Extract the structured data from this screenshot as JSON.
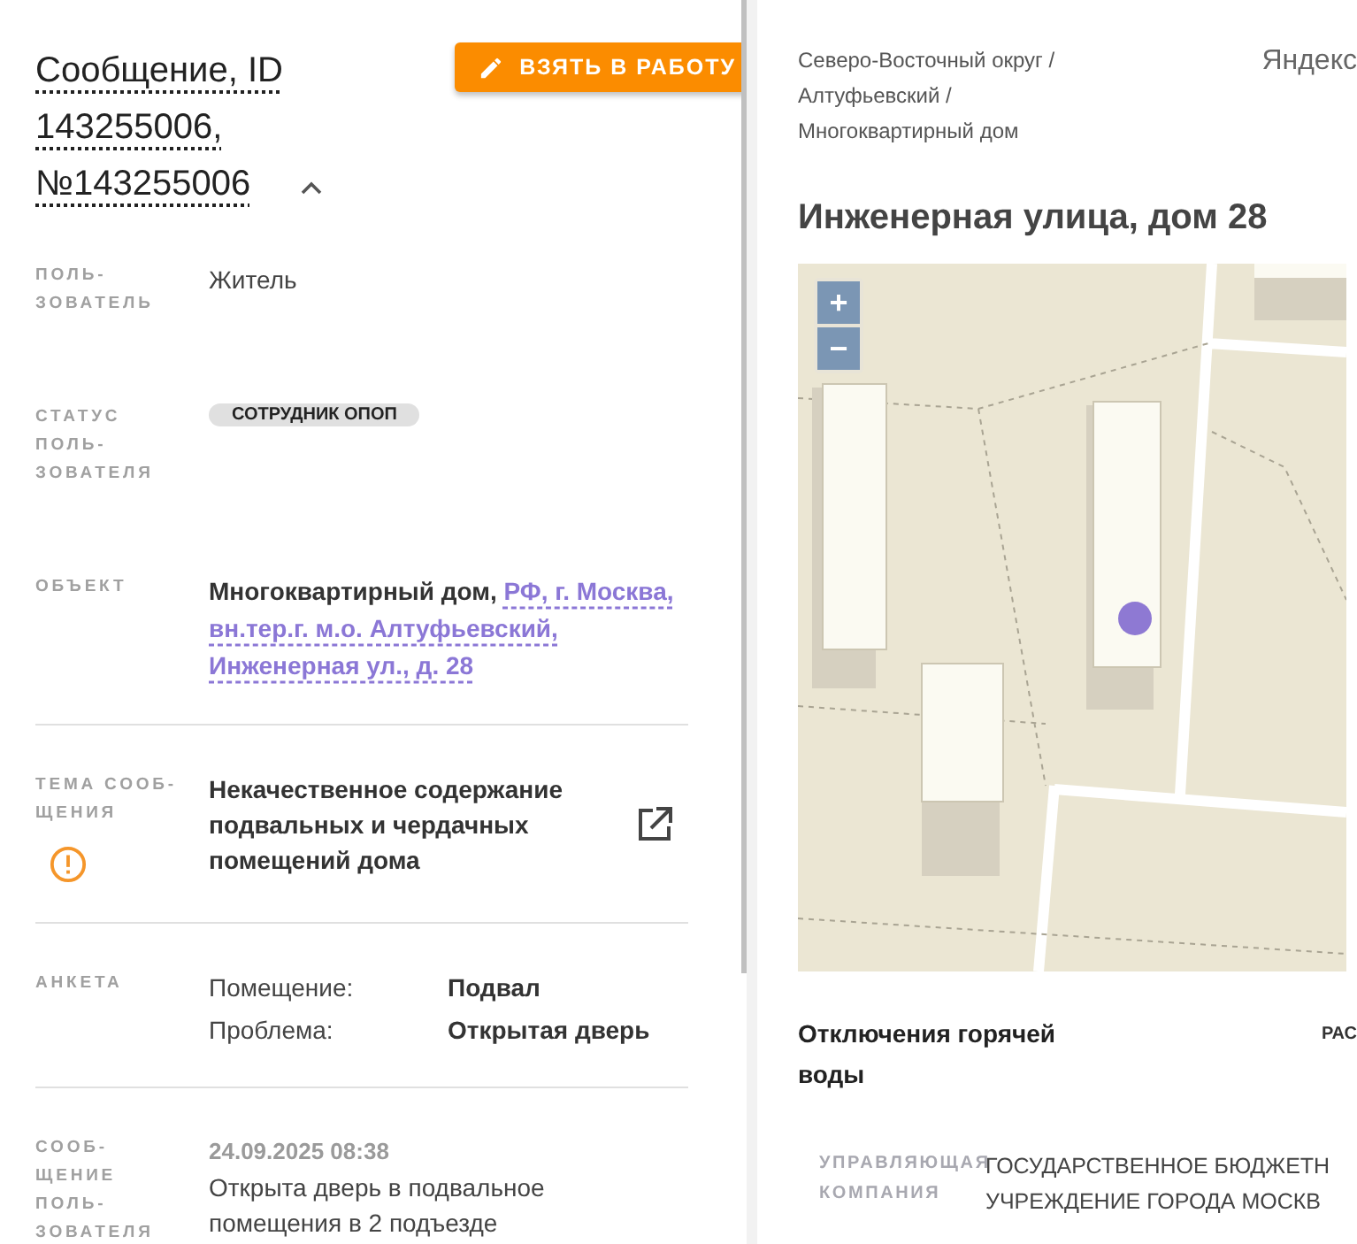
{
  "message": {
    "title": "Сообщение, ID 143255006, №143255006",
    "expanded": true,
    "take_button": "ВЗЯТЬ В РАБОТУ"
  },
  "fields": [
    {
      "kind": "text",
      "label": "ПОЛЬ-ЗОВАТЕЛЬ",
      "value": "Житель"
    },
    {
      "kind": "chip",
      "label": "СТАТУС ПОЛЬ-ЗОВАТЕЛЯ",
      "value": "СОТРУДНИК ОПОП"
    },
    {
      "kind": "object",
      "label": "ОБЪЕКТ",
      "type": "Многоквартирный дом,",
      "address": "РФ, г. Москва, вн.тер.г. м.о. Алтуфьевский, Инженерная ул., д. 28"
    },
    {
      "kind": "topic",
      "label": "ТЕМА СООБ-ЩЕНИЯ",
      "value": "Некачественное содержание подвальных и чердачных помещений дома",
      "warning": true
    },
    {
      "kind": "survey",
      "label": "АНКЕТА",
      "rows": [
        {
          "question": "Помещение:",
          "answer": "Подвал"
        },
        {
          "question": "Проблема:",
          "answer": "Открытая дверь"
        }
      ]
    },
    {
      "kind": "note",
      "label": "СООБ-ЩЕНИЕ ПОЛЬ-ЗОВАТЕЛЯ",
      "date": "24.09.2025 08:38",
      "value": "Открыта дверь в подвальное помещения в 2 подъезде"
    }
  ],
  "location": {
    "breadcrumbs": [
      "Северо-Восточный округ /",
      "Алтуфьевский /",
      "Многоквартирный дом"
    ],
    "map_link": "Яндекс",
    "heading": "Инженерная улица, дом 28",
    "map": {
      "zoom_in": "+",
      "zoom_out": "−"
    }
  },
  "outages": {
    "title": "Отключения горячей воды",
    "column_2": "РАС"
  },
  "management": {
    "label": "УПРАВЛЯЮЩАЯ КОМПАНИЯ",
    "lines": [
      "ГОСУДАРСТВЕННОЕ БЮДЖЕТН",
      "УЧРЕЖДЕНИЕ ГОРОДА МОСКВ"
    ]
  }
}
